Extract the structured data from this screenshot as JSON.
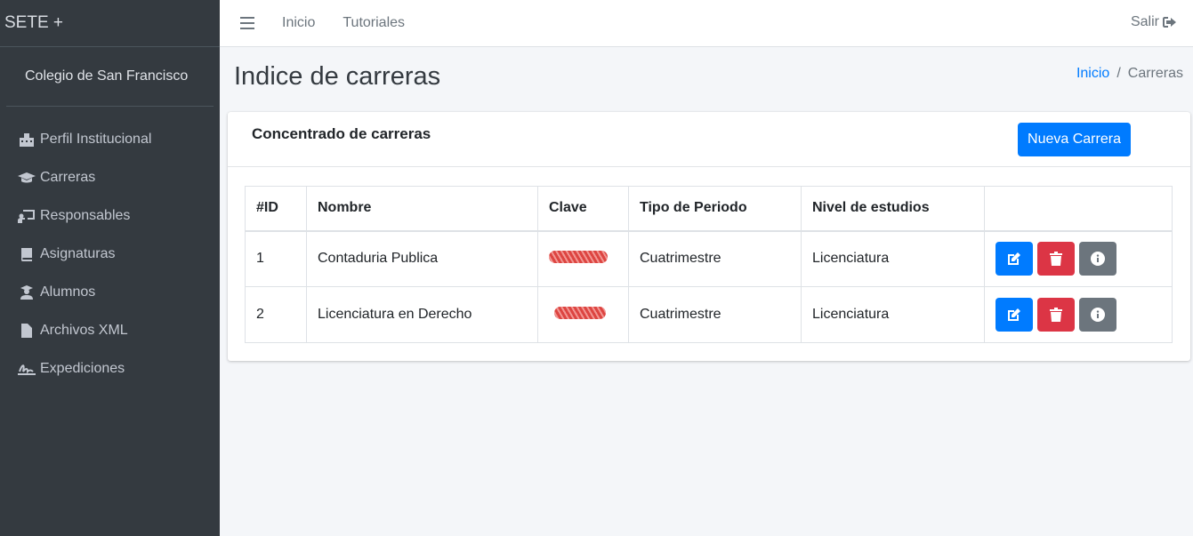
{
  "sidebar": {
    "brand": "SETE +",
    "institution": "Colegio de San Francisco",
    "items": [
      {
        "label": "Perfil Institucional",
        "icon": "building-icon"
      },
      {
        "label": "Carreras",
        "icon": "graduation-cap-icon"
      },
      {
        "label": "Responsables",
        "icon": "chalkboard-teacher-icon"
      },
      {
        "label": "Asignaturas",
        "icon": "book-icon"
      },
      {
        "label": "Alumnos",
        "icon": "user-graduate-icon"
      },
      {
        "label": "Archivos XML",
        "icon": "file-icon"
      },
      {
        "label": "Expediciones",
        "icon": "signature-icon"
      }
    ]
  },
  "topbar": {
    "links": [
      "Inicio",
      "Tutoriales"
    ],
    "logout": "Salir"
  },
  "page": {
    "title": "Indice de carreras",
    "breadcrumb": {
      "home": "Inicio",
      "separator": "/",
      "current": "Carreras"
    }
  },
  "card": {
    "title": "Concentrado de carreras",
    "new_button": "Nueva Carrera",
    "columns": [
      "#ID",
      "Nombre",
      "Clave",
      "Tipo de Periodo",
      "Nivel de estudios",
      ""
    ],
    "rows": [
      {
        "id": "1",
        "nombre": "Contaduria Publica",
        "clave": "",
        "periodo": "Cuatrimestre",
        "nivel": "Licenciatura"
      },
      {
        "id": "2",
        "nombre": "Licenciatura en Derecho",
        "clave": "",
        "periodo": "Cuatrimestre",
        "nivel": "Licenciatura"
      }
    ]
  },
  "colors": {
    "sidebar_bg": "#343a40",
    "primary": "#007bff",
    "danger": "#dc3545",
    "secondary": "#6c757d"
  }
}
